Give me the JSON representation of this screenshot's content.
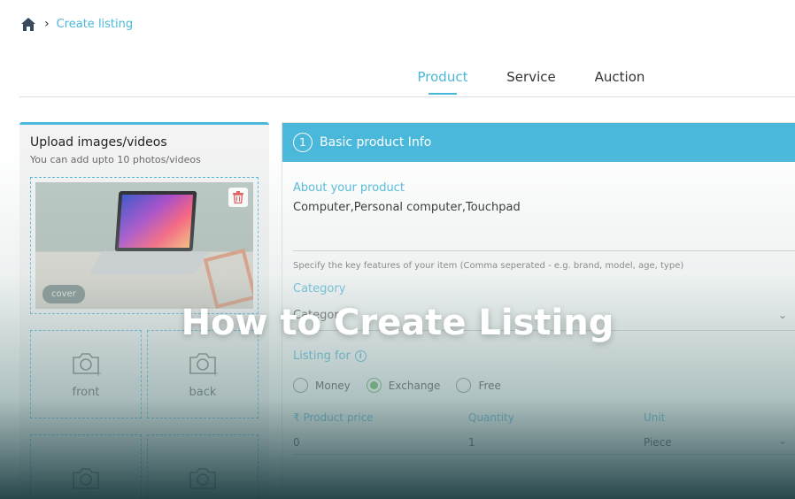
{
  "breadcrumb": {
    "current": "Create listing"
  },
  "tabs": [
    {
      "label": "Product",
      "active": true
    },
    {
      "label": "Service",
      "active": false
    },
    {
      "label": "Auction",
      "active": false
    }
  ],
  "upload": {
    "title": "Upload images/videos",
    "subtitle": "You can add upto 10 photos/videos",
    "cover_badge": "cover",
    "slots": [
      "front",
      "back"
    ]
  },
  "basic_info": {
    "step": "1",
    "title": "Basic product Info",
    "about_label": "About your product",
    "about_value": "Computer,Personal computer,Touchpad",
    "hint": "Specify the key features of your item (Comma seperated - e.g. brand, model, age, type)",
    "category_label": "Category",
    "category_value": "Category",
    "listing_for_label": "Listing for",
    "options": [
      {
        "label": "Money",
        "selected": false
      },
      {
        "label": "Exchange",
        "selected": true
      },
      {
        "label": "Free",
        "selected": false
      }
    ],
    "price_label": "₹ Product price",
    "price_value": "0",
    "quantity_label": "Quantity",
    "quantity_value": "1",
    "unit_label": "Unit",
    "unit_value": "Piece"
  },
  "overlay": {
    "headline": "How to Create Listing"
  },
  "colors": {
    "accent": "#4ab8da",
    "radio_selected": "#5cb85c",
    "trash": "#e05555"
  }
}
